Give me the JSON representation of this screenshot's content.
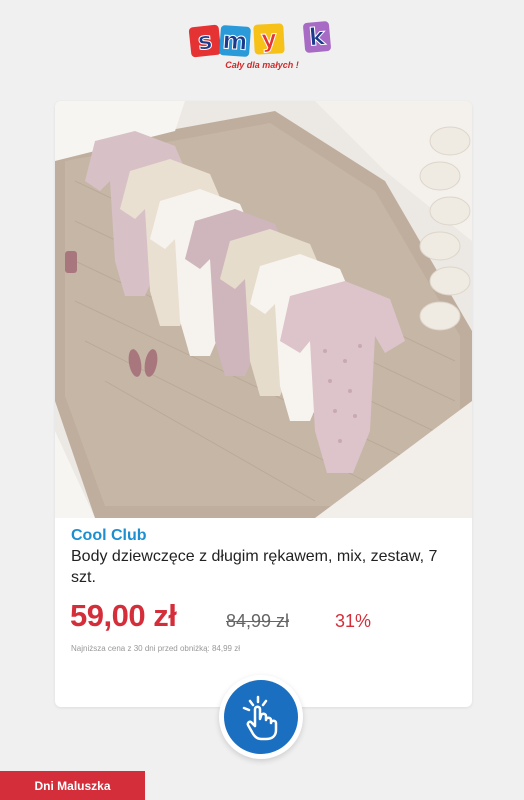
{
  "logo": {
    "letters": [
      "s",
      "m",
      "y",
      "k"
    ],
    "tagline": "Cały dla małych !"
  },
  "product": {
    "image_icon": "baby-bodysuits-photo",
    "brand": "Cool Club",
    "name": "Body dziewczęce z długim rękawem, mix, zestaw, 7 szt.",
    "price": "59,00 zł",
    "old_price": "84,99 zł",
    "discount": "31%",
    "lowest_price_note": "Najniższa cena z 30 dni przed obniżką: 84,99 zł"
  },
  "tap_button": {
    "icon": "tap-hand-icon"
  },
  "footer_tag": {
    "label": "Dni Maluszka"
  },
  "colors": {
    "brand_blue": "#1d8fd1",
    "price_red": "#d42e3a",
    "button_blue": "#1b6fc0"
  }
}
